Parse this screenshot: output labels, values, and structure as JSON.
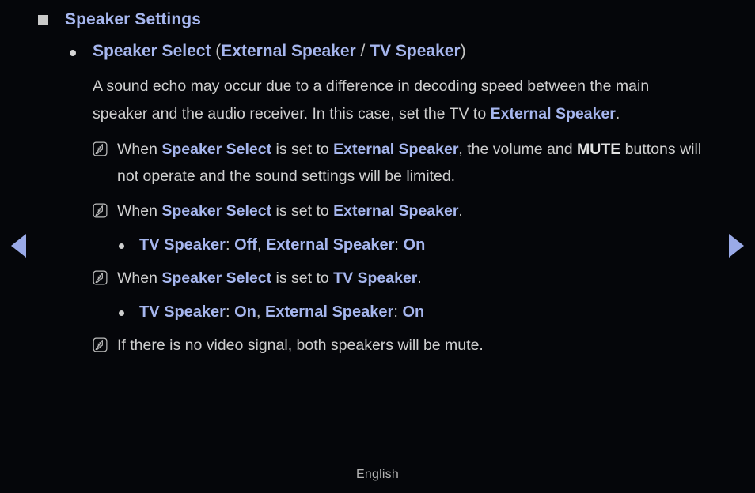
{
  "page": {
    "background_color": "#05060a",
    "accent_color": "#a6b6ee",
    "body_color": "#cfcfcf",
    "footer_language": "English"
  },
  "nav": {
    "prev_label": "◀",
    "prev_name": "previous-page-arrow",
    "next_label": "▶",
    "next_name": "next-page-arrow"
  },
  "heading": {
    "title": "Speaker Settings"
  },
  "bullet": {
    "title": "Speaker Select",
    "paren_open": " (",
    "option_1": "External Speaker",
    "separator": " / ",
    "option_2": "TV Speaker",
    "paren_close": ")"
  },
  "paragraph": {
    "part_1": "A sound echo may occur due to a difference in decoding speed between the main speaker and the audio receiver. In this case, set the TV to ",
    "emphasis": "External Speaker",
    "part_2": "."
  },
  "notes": [
    {
      "icon": "note-pen-icon",
      "t1": "When ",
      "k1": "Speaker Select",
      "t2": " is set to ",
      "k2": "External Speaker",
      "t3": ", the volume and ",
      "k3": "MUTE",
      "t4": " buttons will not operate and the sound settings will be limited."
    },
    {
      "icon": "note-pen-icon",
      "t1": "When ",
      "k1": "Speaker Select",
      "t2": " is set to ",
      "k2": "External Speaker",
      "t3": ".",
      "k3": "",
      "t4": ""
    },
    {
      "icon": "note-pen-icon",
      "t1": "When ",
      "k1": "Speaker Select",
      "t2": " is set to ",
      "k2": "TV Speaker",
      "t3": ".",
      "k3": "",
      "t4": ""
    },
    {
      "icon": "note-pen-icon",
      "t1": "If there is no video signal, both speakers will be mute.",
      "k1": "",
      "t2": "",
      "k2": "",
      "t3": "",
      "k3": "",
      "t4": ""
    }
  ],
  "sub_bullets": [
    {
      "a_label": "TV Speaker",
      "a_colon": ": ",
      "a_value": "Off",
      "comma": ", ",
      "b_label": "External Speaker",
      "b_colon": ": ",
      "b_value": "On"
    },
    {
      "a_label": "TV Speaker",
      "a_colon": ": ",
      "a_value": "On",
      "comma": ", ",
      "b_label": "External Speaker",
      "b_colon": ": ",
      "b_value": "On"
    }
  ]
}
